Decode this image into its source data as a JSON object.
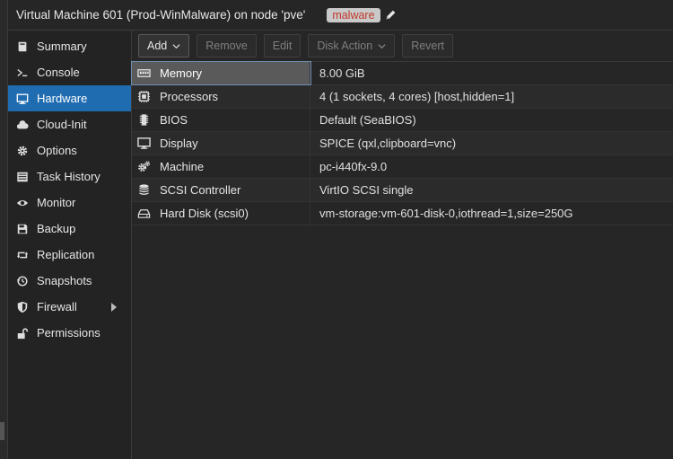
{
  "window": {
    "title": "Virtual Machine 601 (Prod-WinMalware) on node 'pve'",
    "tag": "malware"
  },
  "sidebar": {
    "items": [
      {
        "label": "Summary",
        "icon": "book-icon"
      },
      {
        "label": "Console",
        "icon": "terminal-icon"
      },
      {
        "label": "Hardware",
        "icon": "monitor-icon",
        "active": true
      },
      {
        "label": "Cloud-Init",
        "icon": "cloud-icon"
      },
      {
        "label": "Options",
        "icon": "gear-icon"
      },
      {
        "label": "Task History",
        "icon": "list-icon"
      },
      {
        "label": "Monitor",
        "icon": "eye-icon"
      },
      {
        "label": "Backup",
        "icon": "floppy-icon"
      },
      {
        "label": "Replication",
        "icon": "retweet-icon"
      },
      {
        "label": "Snapshots",
        "icon": "history-icon"
      },
      {
        "label": "Firewall",
        "icon": "shield-icon",
        "submenu": true
      },
      {
        "label": "Permissions",
        "icon": "unlock-icon"
      }
    ]
  },
  "toolbar": {
    "add_label": "Add",
    "remove_label": "Remove",
    "edit_label": "Edit",
    "disk_action_label": "Disk Action",
    "revert_label": "Revert"
  },
  "hardware": {
    "rows": [
      {
        "key": "Memory",
        "value": "8.00 GiB",
        "icon": "memory-icon"
      },
      {
        "key": "Processors",
        "value": "4 (1 sockets, 4 cores) [host,hidden=1]",
        "icon": "cpu-icon"
      },
      {
        "key": "BIOS",
        "value": "Default (SeaBIOS)",
        "icon": "microchip-icon"
      },
      {
        "key": "Display",
        "value": "SPICE (qxl,clipboard=vnc)",
        "icon": "desktop-icon"
      },
      {
        "key": "Machine",
        "value": "pc-i440fx-9.0",
        "icon": "cogs-icon"
      },
      {
        "key": "SCSI Controller",
        "value": "VirtIO SCSI single",
        "icon": "database-icon"
      },
      {
        "key": "Hard Disk (scsi0)",
        "value": "vm-storage:vm-601-disk-0,iothread=1,size=250G",
        "icon": "hdd-icon"
      }
    ]
  },
  "colors": {
    "accent": "#1f6cb0",
    "tag_text": "#c0392b",
    "tag_bg": "#c9c9c9"
  }
}
